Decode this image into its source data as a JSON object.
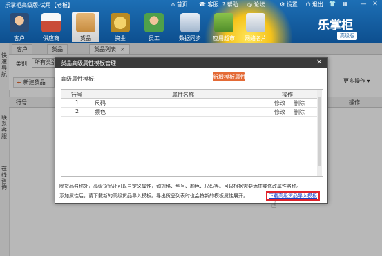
{
  "app": {
    "title": "乐掌柜高级版-试用【老板】",
    "topnav": [
      "首页",
      "客服",
      "帮助",
      "论坛",
      "设置",
      "退出"
    ],
    "window_buttons": [
      "—",
      "✕"
    ],
    "nav": [
      {
        "label": "客户",
        "icon": "customer-icon"
      },
      {
        "label": "供应商",
        "icon": "supplier-icon"
      },
      {
        "label": "货品",
        "icon": "goods-icon"
      },
      {
        "label": "资金",
        "icon": "money-icon"
      },
      {
        "label": "员工",
        "icon": "employee-icon"
      },
      {
        "label": "数据同步",
        "icon": "sync-icon"
      },
      {
        "label": "应用超市",
        "icon": "app-store-icon"
      },
      {
        "label": "网络名片",
        "icon": "namecard-icon"
      }
    ],
    "brand": {
      "name": "乐掌柜",
      "edition": "高级版"
    }
  },
  "sidebar": {
    "items": [
      "快速导航",
      "联系客服",
      "在线咨询"
    ]
  },
  "tabs": [
    "客户",
    "货品",
    "货品列表"
  ],
  "toolbar": {
    "category_label": "类别",
    "category_value": "所有类别",
    "new_button": "新建货品",
    "more_button": "更多操作"
  },
  "grid": {
    "col_rownum": "行号",
    "col_action": "操作"
  },
  "dialog": {
    "title": "货品高级属性模板管理",
    "field_label": "高级属性模板:",
    "add_button": "新增模板属性",
    "columns": {
      "rownum": "行号",
      "name": "属性名称",
      "action": "操作"
    },
    "rows": [
      {
        "no": "1",
        "name": "尺码",
        "edit": "修改",
        "delete": "删除"
      },
      {
        "no": "2",
        "name": "颜色",
        "edit": "修改",
        "delete": "删除"
      }
    ],
    "note1": "除货品名称外，高级货品还可以自定义属性，如规格、型号、颜色、尺码等。可以根据需要添加或修改属性名称。",
    "note2": "添加属性后，请下载新的高级货品导入模板。导出货品列表时也会按新的模板属性展开。",
    "download_link": "下载高级货品导入模板"
  }
}
